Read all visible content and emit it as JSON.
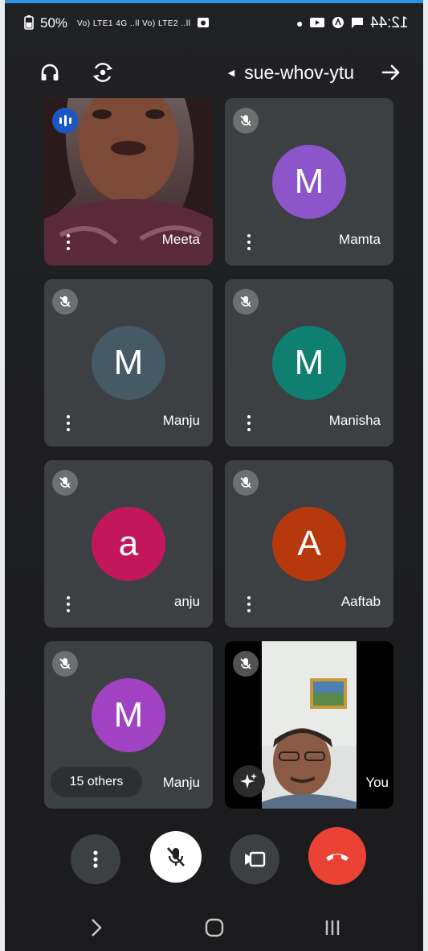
{
  "status_bar": {
    "time": "12:44",
    "battery": "50%",
    "network": "Vo) LTE1 4G ..ll Vo) LTE2 ..ll"
  },
  "meeting": {
    "title": "sue-whov-ytu"
  },
  "tiles": [
    {
      "name": "Mamta",
      "initial": "M",
      "color": "#8c55c9"
    },
    {
      "name": "Meeta"
    },
    {
      "name": "Manisha",
      "initial": "M",
      "color": "#0f7f70"
    },
    {
      "name": "Manju",
      "initial": "M",
      "color": "#455a64"
    },
    {
      "name": "Aaftab",
      "initial": "A",
      "color": "#b8380e"
    },
    {
      "name": "anju",
      "initial": "a",
      "color": "#c2185b"
    },
    {
      "name": "You"
    },
    {
      "name": "Manju",
      "initial": "M",
      "color": "#a142c2",
      "others_label": "15 others"
    }
  ],
  "colors": {
    "background": "#202124",
    "tile": "#3c4043",
    "end_call": "#ea4335",
    "speaking_badge": "#1a56c4"
  }
}
